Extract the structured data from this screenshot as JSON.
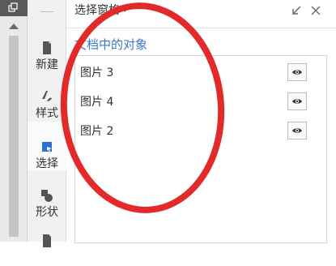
{
  "rail": {
    "items": [
      {
        "label": "新建",
        "icon": "new-doc-icon"
      },
      {
        "label": "样式",
        "icon": "style-brush-icon"
      },
      {
        "label": "选择",
        "icon": "select-arrow-icon",
        "active": true
      },
      {
        "label": "形状",
        "icon": "shapes-icon"
      },
      {
        "label": "",
        "icon": "document-icon"
      }
    ]
  },
  "panel": {
    "title": "选择窗格",
    "section_title": "文档中的对象",
    "objects": [
      {
        "name": "图片 3",
        "visible": true
      },
      {
        "name": "图片 4",
        "visible": true
      },
      {
        "name": "图片 2",
        "visible": true
      }
    ]
  },
  "colors": {
    "accent": "#3b79c7",
    "annotation": "#e32a2a",
    "select_icon": "#2f6fd0"
  }
}
